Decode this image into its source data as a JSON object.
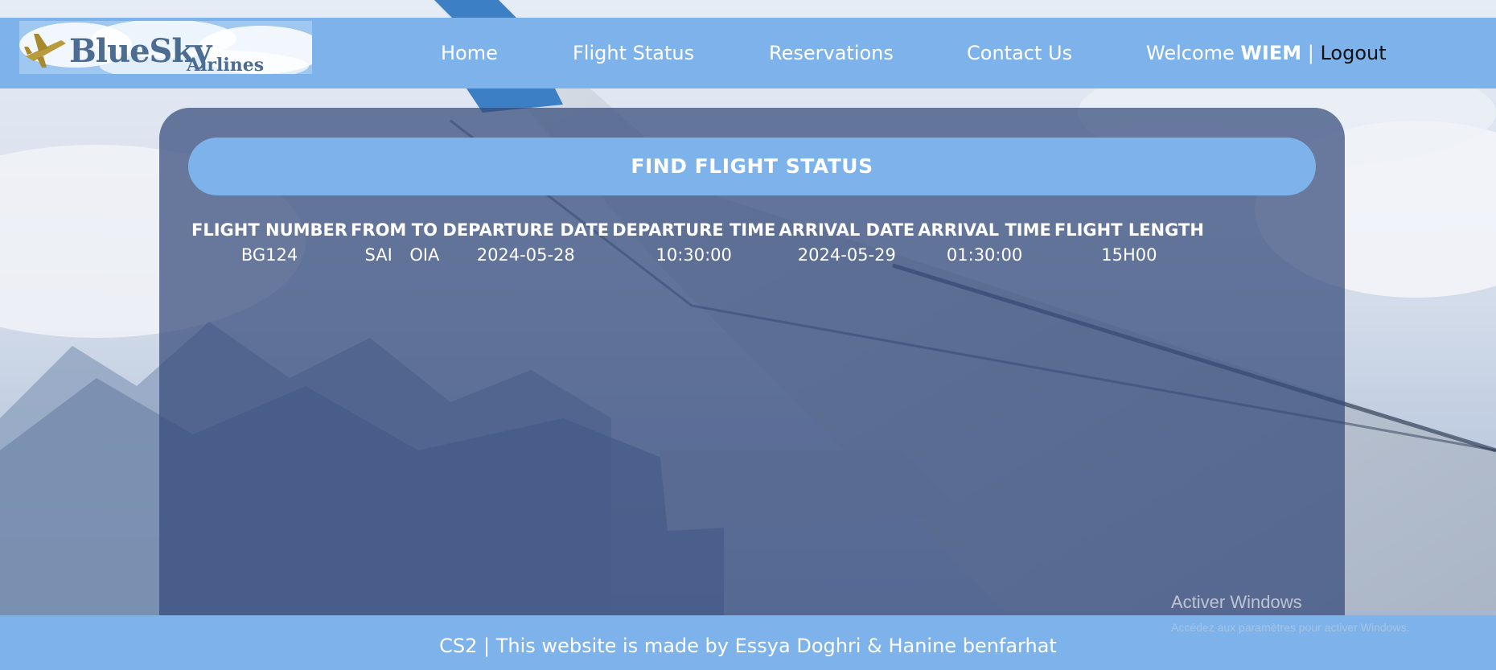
{
  "brand": {
    "name": "BlueSky",
    "sub": "Airlines"
  },
  "nav": {
    "home": "Home",
    "flight_status": "Flight Status",
    "reservations": "Reservations",
    "contact": "Contact Us"
  },
  "user": {
    "welcome": "Welcome",
    "name": "WIEM",
    "separator": "|",
    "logout": "Logout"
  },
  "main": {
    "find_button": "FIND FLIGHT STATUS",
    "table": {
      "headers": [
        "FLIGHT NUMBER",
        "FROM",
        "TO",
        "DEPARTURE DATE",
        "DEPARTURE TIME",
        "ARRIVAL DATE",
        "ARRIVAL TIME",
        "FLIGHT LENGTH"
      ],
      "rows": [
        [
          "BG124",
          "SAI",
          "OIA",
          "2024-05-28",
          "10:30:00",
          "2024-05-29",
          "01:30:00",
          "15H00"
        ]
      ]
    }
  },
  "footer": {
    "text": "CS2 | This website is made by Essya Doghri & Hanine benfarhat"
  },
  "os_watermark": {
    "title": "Activer Windows",
    "subtitle": "Accédez aux paramètres pour activer Windows."
  },
  "colors": {
    "header_bg": "#7db3ea",
    "panel_bg": "#344a7a",
    "text": "#ffffff"
  }
}
